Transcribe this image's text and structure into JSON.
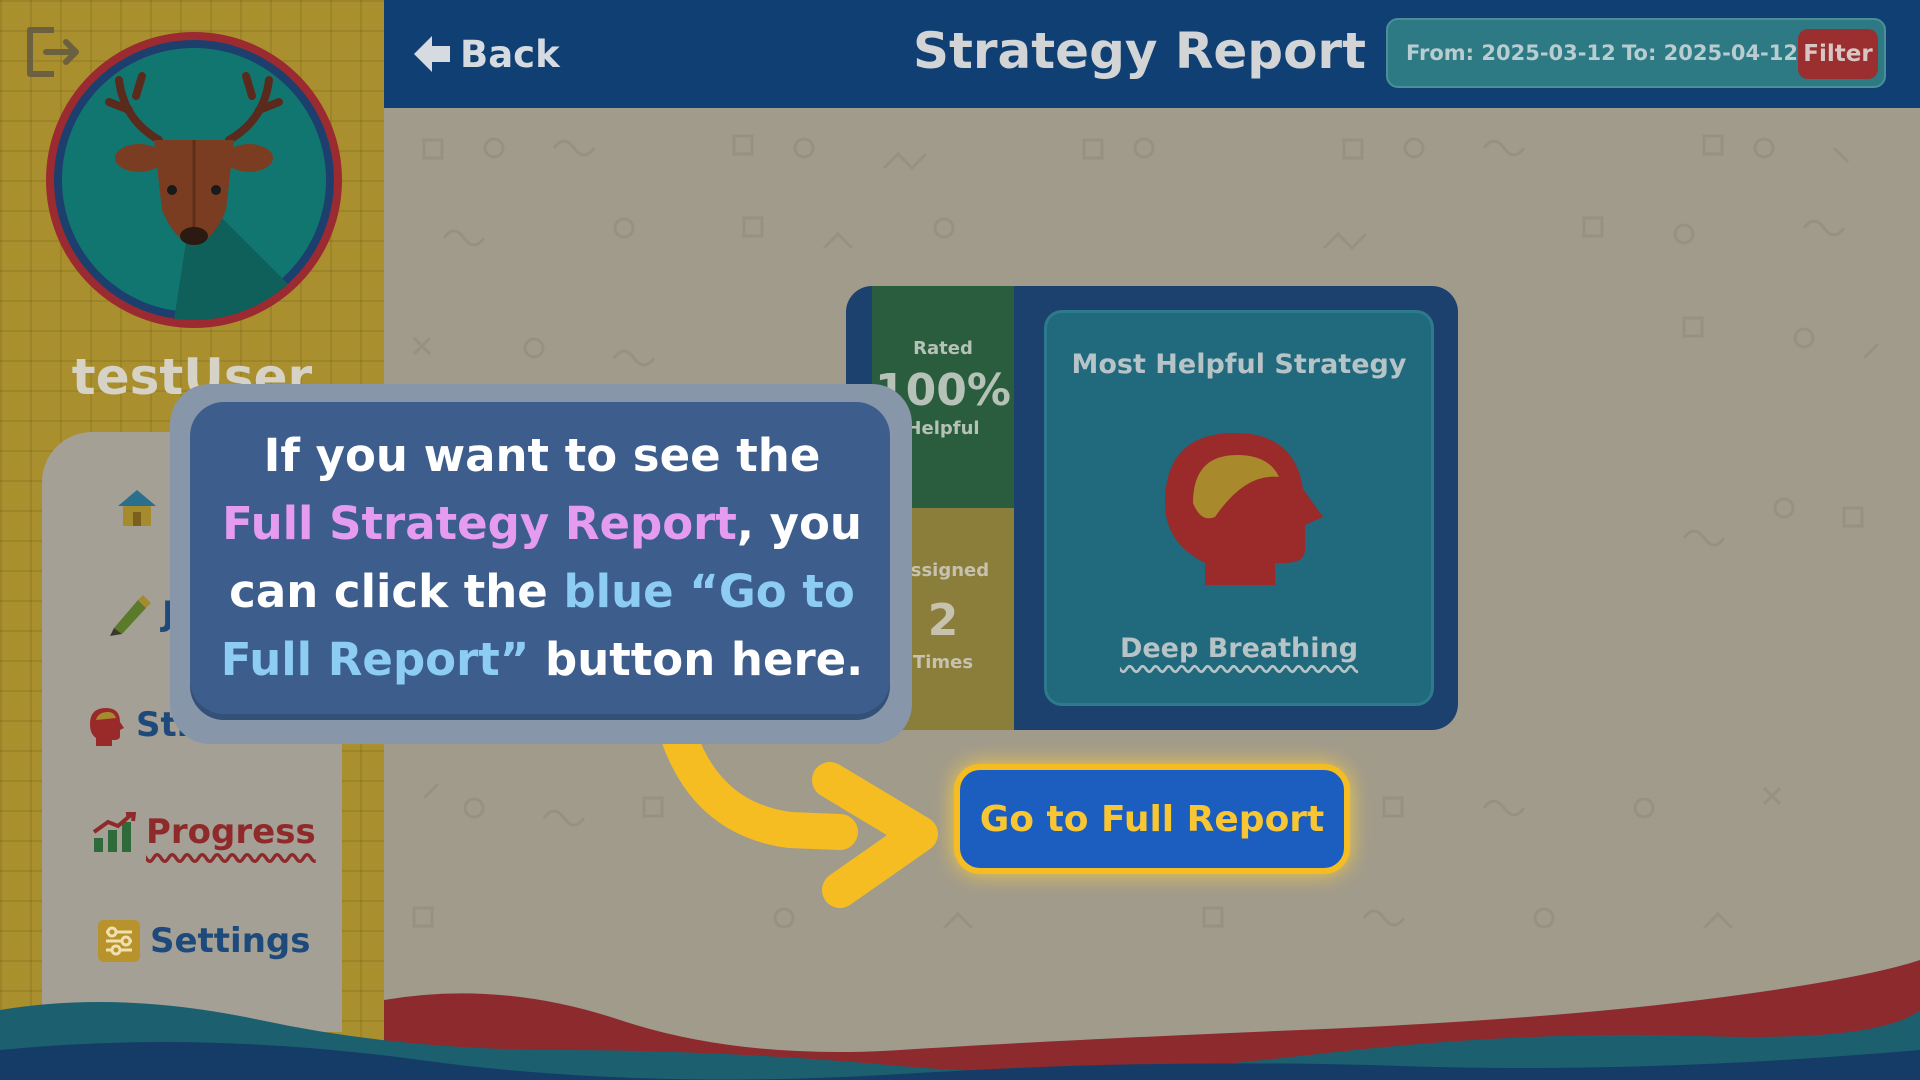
{
  "header": {
    "back_label": "Back",
    "title": "Strategy Report",
    "filter": {
      "from_label": "From: 2025-03-12",
      "to_label": "To: 2025-04-12",
      "button_label": "Filter"
    }
  },
  "sidebar": {
    "username": "testUser",
    "nav": {
      "journal_label": "J",
      "strategies_label": "Stra",
      "progress_label": "Progress",
      "settings_label": "Settings"
    }
  },
  "card": {
    "rated_label": "Rated",
    "rated_value": "100%",
    "helpful_label": "Helpful",
    "assigned_label": "Assigned",
    "assigned_value": "2",
    "times_label": "Times",
    "most_helpful_title": "Most Helpful Strategy",
    "strategy_name": "Deep Breathing"
  },
  "full_report_button_label": "Go to Full Report",
  "tooltip": {
    "part1": "If you want to see the ",
    "highlight1": "Full Strategy Report",
    "part2": ", you can click the ",
    "highlight2": "blue “Go to Full Report”",
    "part3": " button here."
  },
  "colors": {
    "top_bar": "#103f73",
    "accent_yellow": "#f5bd22",
    "button_blue": "#1c5dc0",
    "filter_red": "#9b2e2e",
    "sidebar_gold": "#a98f2d"
  }
}
